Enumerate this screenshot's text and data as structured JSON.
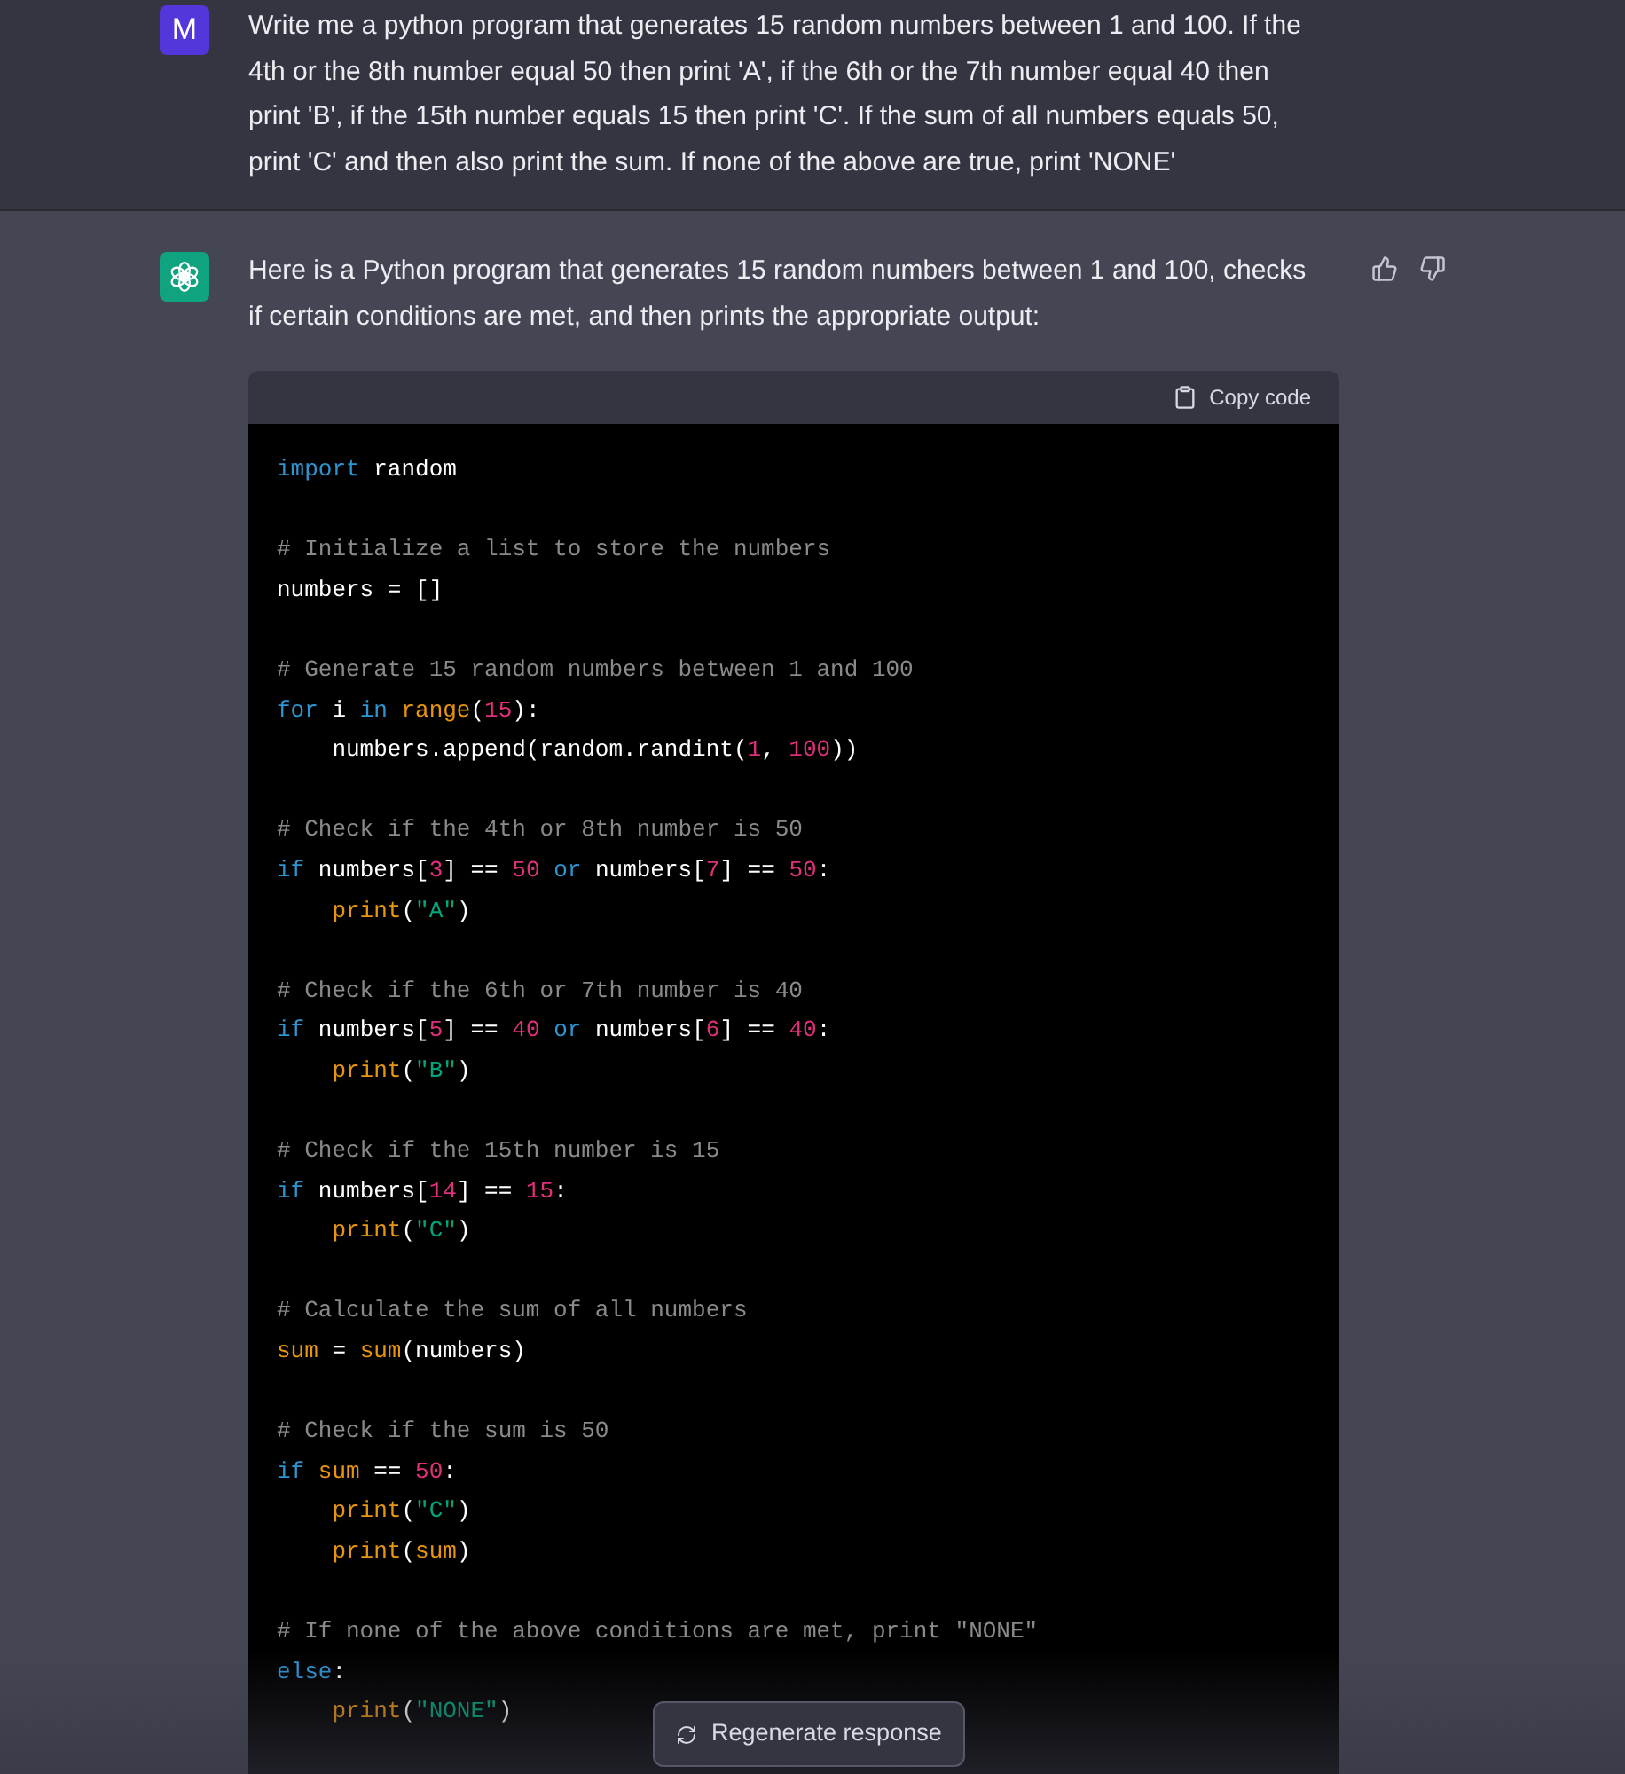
{
  "user_message": {
    "avatar": "M",
    "text": "Write me a python program that generates 15 random numbers between 1 and 100. If the 4th or the 8th number equal 50 then print 'A', if the 6th or the 7th number equal 40 then print 'B', if the 15th number equals 15 then print 'C'. If the sum of all numbers equals 50, print 'C' and then also print the sum. If none of the above are true, print 'NONE'"
  },
  "assistant_message": {
    "text": "Here is a Python program that generates 15 random numbers between 1 and 100, checks if certain conditions are met, and then prints the appropriate output:",
    "code_block": {
      "copy_label": "Copy code",
      "blocks": [
        {
          "lines": [
            [
              {
                "t": "import ",
                "kind": "keyword"
              },
              {
                "t": "random",
                "kind": "plain"
              }
            ]
          ]
        },
        {
          "lines": [
            [
              {
                "t": "# Initialize a list to store the numbers",
                "kind": "comment"
              }
            ],
            [
              {
                "t": "numbers = []",
                "kind": "plain"
              }
            ]
          ]
        },
        {
          "lines": [
            [
              {
                "t": "# Generate 15 random numbers between 1 and 100",
                "kind": "comment"
              }
            ],
            [
              {
                "t": "for",
                "kind": "keyword"
              },
              {
                "t": " i ",
                "kind": "plain"
              },
              {
                "t": "in ",
                "kind": "keyword"
              },
              {
                "t": "range",
                "kind": "builtin"
              },
              {
                "t": "(",
                "kind": "plain"
              },
              {
                "t": "15",
                "kind": "number"
              },
              {
                "t": "):",
                "kind": "plain"
              }
            ],
            [
              {
                "t": "    numbers.append(random.randint(",
                "kind": "plain"
              },
              {
                "t": "1",
                "kind": "number"
              },
              {
                "t": ", ",
                "kind": "plain"
              },
              {
                "t": "100",
                "kind": "number"
              },
              {
                "t": "))",
                "kind": "plain"
              }
            ]
          ]
        },
        {
          "lines": [
            [
              {
                "t": "# Check if the 4th or 8th number is 50",
                "kind": "comment"
              }
            ],
            [
              {
                "t": "if",
                "kind": "keyword"
              },
              {
                "t": " numbers[",
                "kind": "plain"
              },
              {
                "t": "3",
                "kind": "number"
              },
              {
                "t": "] == ",
                "kind": "plain"
              },
              {
                "t": "50 ",
                "kind": "number"
              },
              {
                "t": "or",
                "kind": "keyword"
              },
              {
                "t": " numbers[",
                "kind": "plain"
              },
              {
                "t": "7",
                "kind": "number"
              },
              {
                "t": "] == ",
                "kind": "plain"
              },
              {
                "t": "50",
                "kind": "number"
              },
              {
                "t": ":",
                "kind": "plain"
              }
            ],
            [
              {
                "t": "    print",
                "kind": "builtin"
              },
              {
                "t": "(",
                "kind": "plain"
              },
              {
                "t": "\"A\"",
                "kind": "string"
              },
              {
                "t": ")",
                "kind": "plain"
              }
            ]
          ]
        },
        {
          "lines": [
            [
              {
                "t": "# Check if the 6th or 7th number is 40",
                "kind": "comment"
              }
            ],
            [
              {
                "t": "if",
                "kind": "keyword"
              },
              {
                "t": " numbers[",
                "kind": "plain"
              },
              {
                "t": "5",
                "kind": "number"
              },
              {
                "t": "] == ",
                "kind": "plain"
              },
              {
                "t": "40 ",
                "kind": "number"
              },
              {
                "t": "or",
                "kind": "keyword"
              },
              {
                "t": " numbers[",
                "kind": "plain"
              },
              {
                "t": "6",
                "kind": "number"
              },
              {
                "t": "] == ",
                "kind": "plain"
              },
              {
                "t": "40",
                "kind": "number"
              },
              {
                "t": ":",
                "kind": "plain"
              }
            ],
            [
              {
                "t": "    print",
                "kind": "builtin"
              },
              {
                "t": "(",
                "kind": "plain"
              },
              {
                "t": "\"B\"",
                "kind": "string"
              },
              {
                "t": ")",
                "kind": "plain"
              }
            ]
          ]
        },
        {
          "lines": [
            [
              {
                "t": "# Check if the 15th number is 15",
                "kind": "comment"
              }
            ],
            [
              {
                "t": "if",
                "kind": "keyword"
              },
              {
                "t": " numbers[",
                "kind": "plain"
              },
              {
                "t": "14",
                "kind": "number"
              },
              {
                "t": "] == ",
                "kind": "plain"
              },
              {
                "t": "15",
                "kind": "number"
              },
              {
                "t": ":",
                "kind": "plain"
              }
            ],
            [
              {
                "t": "    print",
                "kind": "builtin"
              },
              {
                "t": "(",
                "kind": "plain"
              },
              {
                "t": "\"C\"",
                "kind": "string"
              },
              {
                "t": ")",
                "kind": "plain"
              }
            ]
          ]
        },
        {
          "lines": [
            [
              {
                "t": "# Calculate the sum of all numbers",
                "kind": "comment"
              }
            ],
            [
              {
                "t": "sum",
                "kind": "builtin"
              },
              {
                "t": " = ",
                "kind": "plain"
              },
              {
                "t": "sum",
                "kind": "builtin"
              },
              {
                "t": "(numbers)",
                "kind": "plain"
              }
            ]
          ]
        },
        {
          "lines": [
            [
              {
                "t": "# Check if the sum is 50",
                "kind": "comment"
              }
            ],
            [
              {
                "t": "if ",
                "kind": "keyword"
              },
              {
                "t": "sum",
                "kind": "builtin"
              },
              {
                "t": " == ",
                "kind": "plain"
              },
              {
                "t": "50",
                "kind": "number"
              },
              {
                "t": ":",
                "kind": "plain"
              }
            ],
            [
              {
                "t": "    print",
                "kind": "builtin"
              },
              {
                "t": "(",
                "kind": "plain"
              },
              {
                "t": "\"C\"",
                "kind": "string"
              },
              {
                "t": ")",
                "kind": "plain"
              }
            ],
            [
              {
                "t": "    print",
                "kind": "builtin"
              },
              {
                "t": "(",
                "kind": "plain"
              },
              {
                "t": "sum",
                "kind": "builtin"
              },
              {
                "t": ")",
                "kind": "plain"
              }
            ]
          ]
        },
        {
          "lines": [
            [
              {
                "t": "# If none of the above conditions are met, print \"NONE\"",
                "kind": "comment"
              }
            ],
            [
              {
                "t": "else",
                "kind": "keyword"
              },
              {
                "t": ":",
                "kind": "plain"
              }
            ],
            [
              {
                "t": "    print",
                "kind": "builtin"
              },
              {
                "t": "(",
                "kind": "plain"
              },
              {
                "t": "\"NONE\"",
                "kind": "string"
              },
              {
                "t": ")",
                "kind": "plain"
              }
            ]
          ]
        }
      ]
    }
  },
  "regenerate_button": {
    "label": "Regenerate response"
  }
}
